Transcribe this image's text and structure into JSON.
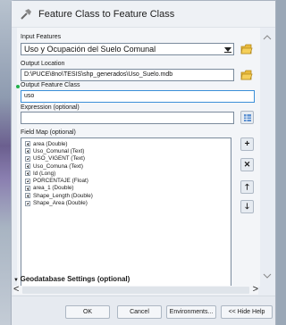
{
  "window": {
    "title": "Feature Class to Feature Class"
  },
  "form": {
    "input_features_label": "Input Features",
    "input_features_value": "Uso y Ocupación del Suelo Comunal",
    "output_location_label": "Output Location",
    "output_location_value": "D:\\PUCE\\8no\\TESIS\\shp_generados\\Uso_Suelo.mdb",
    "output_feature_class_label": "Output Feature Class",
    "output_feature_class_value": "uso",
    "expression_label": "Expression (optional)",
    "expression_value": "",
    "field_map_label": "Field Map (optional)",
    "field_map_items": [
      "area (Double)",
      "Uso_Comunal (Text)",
      "USO_VIGENT (Text)",
      "Uso_Comuna (Text)",
      "Id (Long)",
      "PORCENTAJE (Float)",
      "area_1 (Double)",
      "Shape_Length (Double)",
      "Shape_Area (Double)"
    ],
    "geodatabase_settings_label": "Geodatabase Settings (optional)"
  },
  "buttons": {
    "ok": "OK",
    "cancel": "Cancel",
    "environments": "Environments...",
    "hide_help": "<< Hide Help"
  },
  "icons": {
    "tool": "hammer-icon",
    "folder": "folder-icon",
    "sql": "sql-builder-icon",
    "add": "plus-icon",
    "remove": "x-icon",
    "up": "arrow-up-icon",
    "down": "arrow-down-icon"
  },
  "colors": {
    "required_marker": "#22b14c",
    "active_border": "#3b8fd8"
  }
}
